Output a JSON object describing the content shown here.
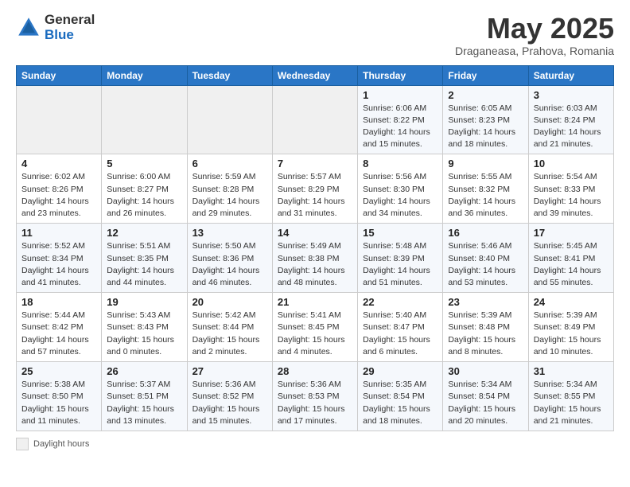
{
  "logo": {
    "general": "General",
    "blue": "Blue"
  },
  "header": {
    "month": "May 2025",
    "location": "Draganeasa, Prahova, Romania"
  },
  "weekdays": [
    "Sunday",
    "Monday",
    "Tuesday",
    "Wednesday",
    "Thursday",
    "Friday",
    "Saturday"
  ],
  "weeks": [
    [
      {
        "day": "",
        "info": ""
      },
      {
        "day": "",
        "info": ""
      },
      {
        "day": "",
        "info": ""
      },
      {
        "day": "",
        "info": ""
      },
      {
        "day": "1",
        "info": "Sunrise: 6:06 AM\nSunset: 8:22 PM\nDaylight: 14 hours\nand 15 minutes."
      },
      {
        "day": "2",
        "info": "Sunrise: 6:05 AM\nSunset: 8:23 PM\nDaylight: 14 hours\nand 18 minutes."
      },
      {
        "day": "3",
        "info": "Sunrise: 6:03 AM\nSunset: 8:24 PM\nDaylight: 14 hours\nand 21 minutes."
      }
    ],
    [
      {
        "day": "4",
        "info": "Sunrise: 6:02 AM\nSunset: 8:26 PM\nDaylight: 14 hours\nand 23 minutes."
      },
      {
        "day": "5",
        "info": "Sunrise: 6:00 AM\nSunset: 8:27 PM\nDaylight: 14 hours\nand 26 minutes."
      },
      {
        "day": "6",
        "info": "Sunrise: 5:59 AM\nSunset: 8:28 PM\nDaylight: 14 hours\nand 29 minutes."
      },
      {
        "day": "7",
        "info": "Sunrise: 5:57 AM\nSunset: 8:29 PM\nDaylight: 14 hours\nand 31 minutes."
      },
      {
        "day": "8",
        "info": "Sunrise: 5:56 AM\nSunset: 8:30 PM\nDaylight: 14 hours\nand 34 minutes."
      },
      {
        "day": "9",
        "info": "Sunrise: 5:55 AM\nSunset: 8:32 PM\nDaylight: 14 hours\nand 36 minutes."
      },
      {
        "day": "10",
        "info": "Sunrise: 5:54 AM\nSunset: 8:33 PM\nDaylight: 14 hours\nand 39 minutes."
      }
    ],
    [
      {
        "day": "11",
        "info": "Sunrise: 5:52 AM\nSunset: 8:34 PM\nDaylight: 14 hours\nand 41 minutes."
      },
      {
        "day": "12",
        "info": "Sunrise: 5:51 AM\nSunset: 8:35 PM\nDaylight: 14 hours\nand 44 minutes."
      },
      {
        "day": "13",
        "info": "Sunrise: 5:50 AM\nSunset: 8:36 PM\nDaylight: 14 hours\nand 46 minutes."
      },
      {
        "day": "14",
        "info": "Sunrise: 5:49 AM\nSunset: 8:38 PM\nDaylight: 14 hours\nand 48 minutes."
      },
      {
        "day": "15",
        "info": "Sunrise: 5:48 AM\nSunset: 8:39 PM\nDaylight: 14 hours\nand 51 minutes."
      },
      {
        "day": "16",
        "info": "Sunrise: 5:46 AM\nSunset: 8:40 PM\nDaylight: 14 hours\nand 53 minutes."
      },
      {
        "day": "17",
        "info": "Sunrise: 5:45 AM\nSunset: 8:41 PM\nDaylight: 14 hours\nand 55 minutes."
      }
    ],
    [
      {
        "day": "18",
        "info": "Sunrise: 5:44 AM\nSunset: 8:42 PM\nDaylight: 14 hours\nand 57 minutes."
      },
      {
        "day": "19",
        "info": "Sunrise: 5:43 AM\nSunset: 8:43 PM\nDaylight: 15 hours\nand 0 minutes."
      },
      {
        "day": "20",
        "info": "Sunrise: 5:42 AM\nSunset: 8:44 PM\nDaylight: 15 hours\nand 2 minutes."
      },
      {
        "day": "21",
        "info": "Sunrise: 5:41 AM\nSunset: 8:45 PM\nDaylight: 15 hours\nand 4 minutes."
      },
      {
        "day": "22",
        "info": "Sunrise: 5:40 AM\nSunset: 8:47 PM\nDaylight: 15 hours\nand 6 minutes."
      },
      {
        "day": "23",
        "info": "Sunrise: 5:39 AM\nSunset: 8:48 PM\nDaylight: 15 hours\nand 8 minutes."
      },
      {
        "day": "24",
        "info": "Sunrise: 5:39 AM\nSunset: 8:49 PM\nDaylight: 15 hours\nand 10 minutes."
      }
    ],
    [
      {
        "day": "25",
        "info": "Sunrise: 5:38 AM\nSunset: 8:50 PM\nDaylight: 15 hours\nand 11 minutes."
      },
      {
        "day": "26",
        "info": "Sunrise: 5:37 AM\nSunset: 8:51 PM\nDaylight: 15 hours\nand 13 minutes."
      },
      {
        "day": "27",
        "info": "Sunrise: 5:36 AM\nSunset: 8:52 PM\nDaylight: 15 hours\nand 15 minutes."
      },
      {
        "day": "28",
        "info": "Sunrise: 5:36 AM\nSunset: 8:53 PM\nDaylight: 15 hours\nand 17 minutes."
      },
      {
        "day": "29",
        "info": "Sunrise: 5:35 AM\nSunset: 8:54 PM\nDaylight: 15 hours\nand 18 minutes."
      },
      {
        "day": "30",
        "info": "Sunrise: 5:34 AM\nSunset: 8:54 PM\nDaylight: 15 hours\nand 20 minutes."
      },
      {
        "day": "31",
        "info": "Sunrise: 5:34 AM\nSunset: 8:55 PM\nDaylight: 15 hours\nand 21 minutes."
      }
    ]
  ],
  "footer": {
    "legend_label": "Daylight hours"
  }
}
